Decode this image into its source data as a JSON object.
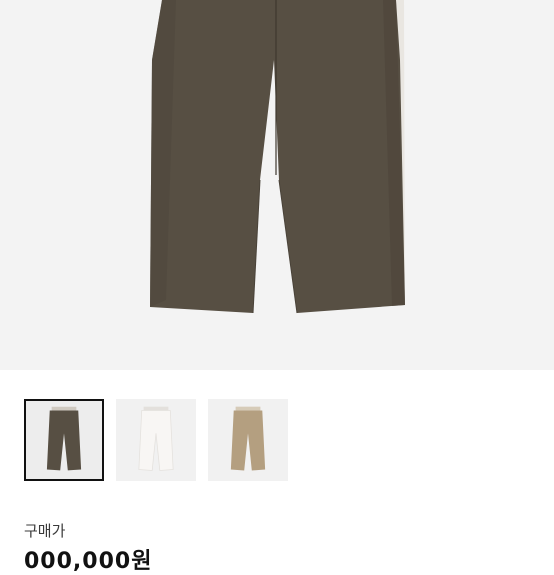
{
  "product": {
    "image_subject": "wide-leg-pants",
    "main_color": "#574f43",
    "thumbnails": [
      {
        "color": "#574f43",
        "selected": true
      },
      {
        "color": "#f6f4f2",
        "selected": false
      },
      {
        "color": "#b49f80",
        "selected": false
      }
    ]
  },
  "purchase": {
    "price_label": "구매가",
    "price_value": "000,000원"
  }
}
